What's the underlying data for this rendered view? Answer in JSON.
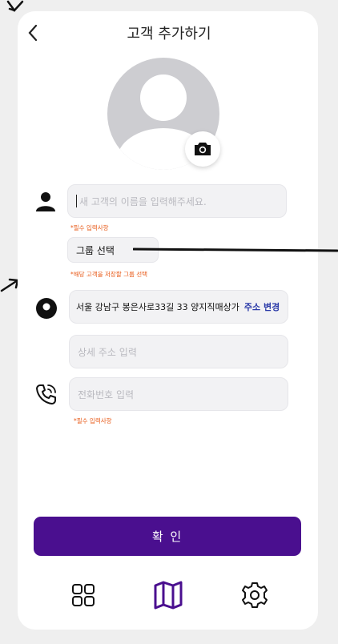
{
  "header": {
    "title": "고객 추가하기"
  },
  "form": {
    "name_placeholder": "새 고객의 이름을 입력해주세요.",
    "name_hint": "*필수 입력사항",
    "group_label": "그룹 선택",
    "group_hint": "*해당 고객을 저장할 그룹 선택",
    "address_value": "서울 강남구 봉은사로33길 33 양지직매상가",
    "address_change_label": "주소 변경",
    "detail_address_placeholder": "상세 주소 입력",
    "phone_placeholder": "전화번호 입력",
    "phone_hint": "*필수 입력사항"
  },
  "actions": {
    "confirm_label": "확 인"
  },
  "colors": {
    "primary": "#4a0f8f",
    "hint": "#e85b1a",
    "link": "#2b3aa8"
  },
  "icons": [
    "chevron-left-icon",
    "camera-icon",
    "person-icon",
    "location-pin-icon",
    "phone-icon",
    "grid-icon",
    "map-icon",
    "gear-icon"
  ]
}
